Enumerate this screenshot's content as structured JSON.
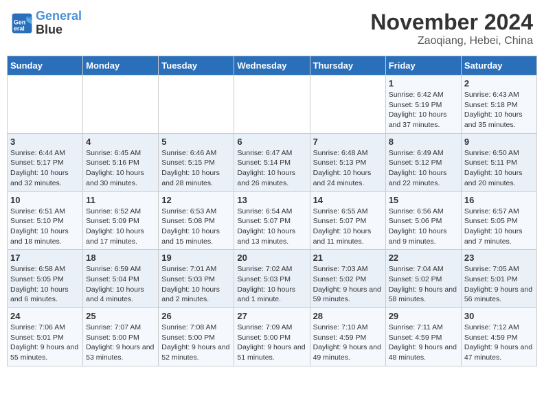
{
  "header": {
    "logo_line1": "General",
    "logo_line2": "Blue",
    "month": "November 2024",
    "location": "Zaoqiang, Hebei, China"
  },
  "weekdays": [
    "Sunday",
    "Monday",
    "Tuesday",
    "Wednesday",
    "Thursday",
    "Friday",
    "Saturday"
  ],
  "rows": [
    [
      {
        "day": "",
        "text": ""
      },
      {
        "day": "",
        "text": ""
      },
      {
        "day": "",
        "text": ""
      },
      {
        "day": "",
        "text": ""
      },
      {
        "day": "",
        "text": ""
      },
      {
        "day": "1",
        "text": "Sunrise: 6:42 AM\nSunset: 5:19 PM\nDaylight: 10 hours and 37 minutes."
      },
      {
        "day": "2",
        "text": "Sunrise: 6:43 AM\nSunset: 5:18 PM\nDaylight: 10 hours and 35 minutes."
      }
    ],
    [
      {
        "day": "3",
        "text": "Sunrise: 6:44 AM\nSunset: 5:17 PM\nDaylight: 10 hours and 32 minutes."
      },
      {
        "day": "4",
        "text": "Sunrise: 6:45 AM\nSunset: 5:16 PM\nDaylight: 10 hours and 30 minutes."
      },
      {
        "day": "5",
        "text": "Sunrise: 6:46 AM\nSunset: 5:15 PM\nDaylight: 10 hours and 28 minutes."
      },
      {
        "day": "6",
        "text": "Sunrise: 6:47 AM\nSunset: 5:14 PM\nDaylight: 10 hours and 26 minutes."
      },
      {
        "day": "7",
        "text": "Sunrise: 6:48 AM\nSunset: 5:13 PM\nDaylight: 10 hours and 24 minutes."
      },
      {
        "day": "8",
        "text": "Sunrise: 6:49 AM\nSunset: 5:12 PM\nDaylight: 10 hours and 22 minutes."
      },
      {
        "day": "9",
        "text": "Sunrise: 6:50 AM\nSunset: 5:11 PM\nDaylight: 10 hours and 20 minutes."
      }
    ],
    [
      {
        "day": "10",
        "text": "Sunrise: 6:51 AM\nSunset: 5:10 PM\nDaylight: 10 hours and 18 minutes."
      },
      {
        "day": "11",
        "text": "Sunrise: 6:52 AM\nSunset: 5:09 PM\nDaylight: 10 hours and 17 minutes."
      },
      {
        "day": "12",
        "text": "Sunrise: 6:53 AM\nSunset: 5:08 PM\nDaylight: 10 hours and 15 minutes."
      },
      {
        "day": "13",
        "text": "Sunrise: 6:54 AM\nSunset: 5:07 PM\nDaylight: 10 hours and 13 minutes."
      },
      {
        "day": "14",
        "text": "Sunrise: 6:55 AM\nSunset: 5:07 PM\nDaylight: 10 hours and 11 minutes."
      },
      {
        "day": "15",
        "text": "Sunrise: 6:56 AM\nSunset: 5:06 PM\nDaylight: 10 hours and 9 minutes."
      },
      {
        "day": "16",
        "text": "Sunrise: 6:57 AM\nSunset: 5:05 PM\nDaylight: 10 hours and 7 minutes."
      }
    ],
    [
      {
        "day": "17",
        "text": "Sunrise: 6:58 AM\nSunset: 5:05 PM\nDaylight: 10 hours and 6 minutes."
      },
      {
        "day": "18",
        "text": "Sunrise: 6:59 AM\nSunset: 5:04 PM\nDaylight: 10 hours and 4 minutes."
      },
      {
        "day": "19",
        "text": "Sunrise: 7:01 AM\nSunset: 5:03 PM\nDaylight: 10 hours and 2 minutes."
      },
      {
        "day": "20",
        "text": "Sunrise: 7:02 AM\nSunset: 5:03 PM\nDaylight: 10 hours and 1 minute."
      },
      {
        "day": "21",
        "text": "Sunrise: 7:03 AM\nSunset: 5:02 PM\nDaylight: 9 hours and 59 minutes."
      },
      {
        "day": "22",
        "text": "Sunrise: 7:04 AM\nSunset: 5:02 PM\nDaylight: 9 hours and 58 minutes."
      },
      {
        "day": "23",
        "text": "Sunrise: 7:05 AM\nSunset: 5:01 PM\nDaylight: 9 hours and 56 minutes."
      }
    ],
    [
      {
        "day": "24",
        "text": "Sunrise: 7:06 AM\nSunset: 5:01 PM\nDaylight: 9 hours and 55 minutes."
      },
      {
        "day": "25",
        "text": "Sunrise: 7:07 AM\nSunset: 5:00 PM\nDaylight: 9 hours and 53 minutes."
      },
      {
        "day": "26",
        "text": "Sunrise: 7:08 AM\nSunset: 5:00 PM\nDaylight: 9 hours and 52 minutes."
      },
      {
        "day": "27",
        "text": "Sunrise: 7:09 AM\nSunset: 5:00 PM\nDaylight: 9 hours and 51 minutes."
      },
      {
        "day": "28",
        "text": "Sunrise: 7:10 AM\nSunset: 4:59 PM\nDaylight: 9 hours and 49 minutes."
      },
      {
        "day": "29",
        "text": "Sunrise: 7:11 AM\nSunset: 4:59 PM\nDaylight: 9 hours and 48 minutes."
      },
      {
        "day": "30",
        "text": "Sunrise: 7:12 AM\nSunset: 4:59 PM\nDaylight: 9 hours and 47 minutes."
      }
    ]
  ]
}
